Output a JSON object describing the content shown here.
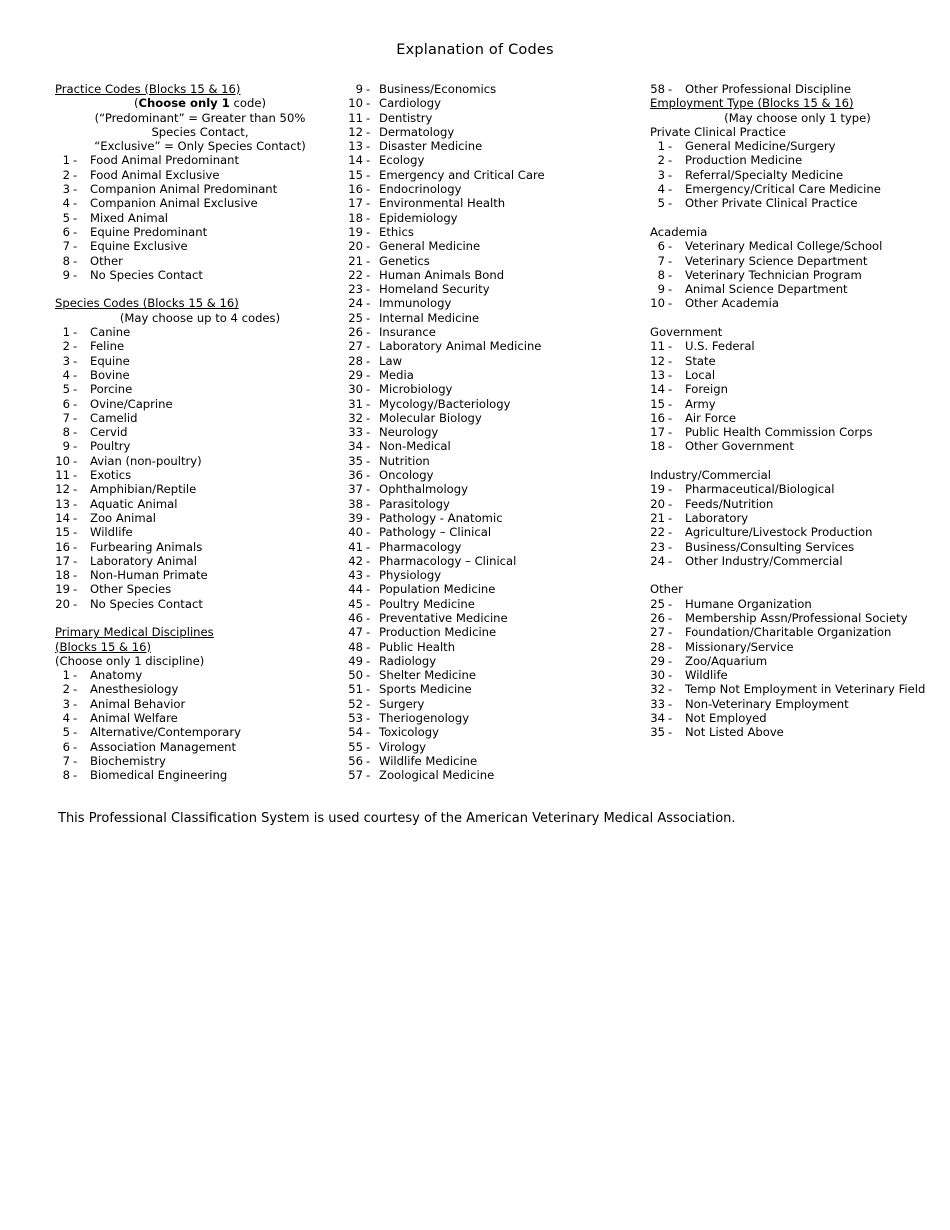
{
  "document": {
    "title": "Explanation of Codes",
    "footer_note": "This Professional Classification System is used courtesy of the American Veterinary Medical Association."
  },
  "sections": {
    "practice_codes": {
      "heading": "Practice Codes (Blocks 15 & 16)",
      "sub_bold_prefix": "(",
      "sub_bold": "Choose only 1",
      "sub_bold_suffix": " code)",
      "sub_line2": "(“Predominant” = Greater than 50%",
      "sub_line3": "Species Contact,",
      "sub_line4": "“Exclusive” = Only Species Contact)",
      "items": [
        {
          "num": "1",
          "label": "Food Animal Predominant"
        },
        {
          "num": "2",
          "label": "Food Animal Exclusive"
        },
        {
          "num": "3",
          "label": "Companion Animal Predominant"
        },
        {
          "num": "4",
          "label": "Companion Animal Exclusive"
        },
        {
          "num": "5",
          "label": "Mixed Animal"
        },
        {
          "num": "6",
          "label": "Equine Predominant"
        },
        {
          "num": "7",
          "label": "Equine Exclusive"
        },
        {
          "num": "8",
          "label": "Other"
        },
        {
          "num": "9",
          "label": "No Species Contact"
        }
      ]
    },
    "species_codes": {
      "heading": "Species Codes (Blocks 15 & 16)",
      "sub": "(May choose up to 4 codes)",
      "items": [
        {
          "num": "1",
          "label": "Canine"
        },
        {
          "num": "2",
          "label": "Feline"
        },
        {
          "num": "3",
          "label": "Equine"
        },
        {
          "num": "4",
          "label": "Bovine"
        },
        {
          "num": "5",
          "label": "Porcine"
        },
        {
          "num": "6",
          "label": "Ovine/Caprine"
        },
        {
          "num": "7",
          "label": "Camelid"
        },
        {
          "num": "8",
          "label": "Cervid"
        },
        {
          "num": "9",
          "label": "Poultry"
        },
        {
          "num": "10",
          "label": "Avian (non-poultry)"
        },
        {
          "num": "11",
          "label": "Exotics"
        },
        {
          "num": "12",
          "label": "Amphibian/Reptile"
        },
        {
          "num": "13",
          "label": "Aquatic Animal"
        },
        {
          "num": "14",
          "label": "Zoo Animal"
        },
        {
          "num": "15",
          "label": "Wildlife"
        },
        {
          "num": "16",
          "label": "Furbearing Animals"
        },
        {
          "num": "17",
          "label": "Laboratory Animal"
        },
        {
          "num": "18",
          "label": "Non-Human Primate"
        },
        {
          "num": "19",
          "label": "Other Species"
        },
        {
          "num": "20",
          "label": "No Species Contact"
        }
      ]
    },
    "primary_medical_disciplines": {
      "heading_line1": "Primary Medical Disciplines",
      "heading_line2": "(Blocks 15 & 16)",
      "sub": "(Choose only 1 discipline)",
      "items_col1": [
        {
          "num": "1",
          "label": "Anatomy"
        },
        {
          "num": "2",
          "label": "Anesthesiology"
        },
        {
          "num": "3",
          "label": "Animal Behavior"
        },
        {
          "num": "4",
          "label": "Animal Welfare"
        },
        {
          "num": "5",
          "label": "Alternative/Contemporary"
        },
        {
          "num": "6",
          "label": "Association Management"
        },
        {
          "num": "7",
          "label": "Biochemistry"
        },
        {
          "num": "8",
          "label": "Biomedical Engineering"
        }
      ],
      "items_col2": [
        {
          "num": "9",
          "label": "Business/Economics"
        },
        {
          "num": "10",
          "label": "Cardiology"
        },
        {
          "num": "11",
          "label": "Dentistry"
        },
        {
          "num": "12",
          "label": "Dermatology"
        },
        {
          "num": "13",
          "label": "Disaster Medicine"
        },
        {
          "num": "14",
          "label": "Ecology"
        },
        {
          "num": "15",
          "label": "Emergency and Critical Care"
        },
        {
          "num": "16",
          "label": "Endocrinology"
        },
        {
          "num": "17",
          "label": "Environmental Health"
        },
        {
          "num": "18",
          "label": "Epidemiology"
        },
        {
          "num": "19",
          "label": "Ethics"
        },
        {
          "num": "20",
          "label": "General Medicine"
        },
        {
          "num": "21",
          "label": "Genetics"
        },
        {
          "num": "22",
          "label": "Human Animals Bond"
        },
        {
          "num": "23",
          "label": "Homeland Security"
        },
        {
          "num": "24",
          "label": "Immunology"
        },
        {
          "num": "25",
          "label": "Internal Medicine"
        },
        {
          "num": "26",
          "label": "Insurance"
        },
        {
          "num": "27",
          "label": "Laboratory Animal Medicine"
        },
        {
          "num": "28",
          "label": "Law"
        },
        {
          "num": "29",
          "label": "Media"
        },
        {
          "num": "30",
          "label": "Microbiology"
        },
        {
          "num": "31",
          "label": "Mycology/Bacteriology"
        },
        {
          "num": "32",
          "label": "Molecular Biology"
        },
        {
          "num": "33",
          "label": "Neurology"
        },
        {
          "num": "34",
          "label": "Non-Medical"
        },
        {
          "num": "35",
          "label": "Nutrition"
        },
        {
          "num": "36",
          "label": "Oncology"
        },
        {
          "num": "37",
          "label": "Ophthalmology"
        },
        {
          "num": "38",
          "label": "Parasitology"
        },
        {
          "num": "39",
          "label": "Pathology - Anatomic"
        },
        {
          "num": "40",
          "label": "Pathology – Clinical"
        },
        {
          "num": "41",
          "label": "Pharmacology"
        },
        {
          "num": "42",
          "label": "Pharmacology – Clinical"
        },
        {
          "num": "43",
          "label": "Physiology"
        },
        {
          "num": "44",
          "label": "Population Medicine"
        },
        {
          "num": "45",
          "label": "Poultry Medicine"
        },
        {
          "num": "46",
          "label": "Preventative Medicine"
        },
        {
          "num": "47",
          "label": "Production Medicine"
        },
        {
          "num": "48",
          "label": "Public Health"
        },
        {
          "num": "49",
          "label": "Radiology"
        },
        {
          "num": "50",
          "label": "Shelter Medicine"
        },
        {
          "num": "51",
          "label": "Sports Medicine"
        },
        {
          "num": "52",
          "label": "Surgery"
        },
        {
          "num": "53",
          "label": "Theriogenology"
        },
        {
          "num": "54",
          "label": "Toxicology"
        },
        {
          "num": "55",
          "label": "Virology"
        },
        {
          "num": "56",
          "label": "Wildlife Medicine"
        },
        {
          "num": "57",
          "label": "Zoological Medicine"
        }
      ],
      "items_col3": [
        {
          "num": "58",
          "label": "Other Professional Discipline"
        }
      ]
    },
    "employment_type": {
      "heading": "Employment Type (Blocks 15 & 16)",
      "sub": "(May choose only 1 type)",
      "groups": [
        {
          "name": "Private Clinical Practice",
          "items": [
            {
              "num": "1",
              "label": "General Medicine/Surgery"
            },
            {
              "num": "2",
              "label": "Production Medicine"
            },
            {
              "num": "3",
              "label": "Referral/Specialty Medicine"
            },
            {
              "num": "4",
              "label": "Emergency/Critical Care Medicine"
            },
            {
              "num": "5",
              "label": "Other Private Clinical Practice"
            }
          ]
        },
        {
          "name": "Academia",
          "items": [
            {
              "num": "6",
              "label": "Veterinary Medical College/School"
            },
            {
              "num": "7",
              "label": "Veterinary Science Department"
            },
            {
              "num": "8",
              "label": "Veterinary Technician Program"
            },
            {
              "num": "9",
              "label": "Animal Science Department"
            },
            {
              "num": "10",
              "label": "Other Academia"
            }
          ]
        },
        {
          "name": "Government",
          "items": [
            {
              "num": "11",
              "label": "U.S. Federal"
            },
            {
              "num": "12",
              "label": "State"
            },
            {
              "num": "13",
              "label": "Local"
            },
            {
              "num": "14",
              "label": "Foreign"
            },
            {
              "num": "15",
              "label": "Army"
            },
            {
              "num": "16",
              "label": "Air Force"
            },
            {
              "num": "17",
              "label": "Public Health Commission Corps"
            },
            {
              "num": "18",
              "label": "Other Government"
            }
          ]
        },
        {
          "name": "Industry/Commercial",
          "items": [
            {
              "num": "19",
              "label": "Pharmaceutical/Biological"
            },
            {
              "num": "20",
              "label": "Feeds/Nutrition"
            },
            {
              "num": "21",
              "label": "Laboratory"
            },
            {
              "num": "22",
              "label": "Agriculture/Livestock Production"
            },
            {
              "num": "23",
              "label": "Business/Consulting Services"
            },
            {
              "num": "24",
              "label": "Other Industry/Commercial"
            }
          ]
        },
        {
          "name": "Other",
          "items": [
            {
              "num": "25",
              "label": "Humane Organization"
            },
            {
              "num": "26",
              "label": "Membership Assn/Professional Society"
            },
            {
              "num": "27",
              "label": "Foundation/Charitable Organization"
            },
            {
              "num": "28",
              "label": "Missionary/Service"
            },
            {
              "num": "29",
              "label": "Zoo/Aquarium"
            },
            {
              "num": "30",
              "label": "Wildlife"
            },
            {
              "num": "32",
              "label": "Temp Not Employment in Veterinary Field"
            },
            {
              "num": "33",
              "label": "Non-Veterinary Employment"
            },
            {
              "num": "34",
              "label": "Not Employed"
            },
            {
              "num": "35",
              "label": "Not Listed Above"
            }
          ]
        }
      ]
    }
  }
}
